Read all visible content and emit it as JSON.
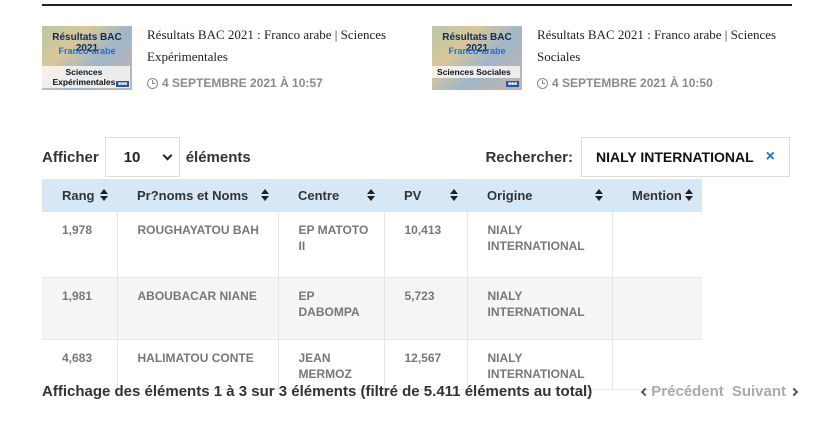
{
  "related": [
    {
      "thumb_line1": "Résultats BAC 2021",
      "thumb_line2": "Franco-arabe",
      "thumb_line3": "Sciences Expérimentales",
      "title": "Résultats BAC 2021 : Franco arabe | Sciences Expérimentales",
      "date": "4 SEPTEMBRE 2021 À 10:57"
    },
    {
      "thumb_line1": "Résultats BAC 2021",
      "thumb_line2": "Franco-arabe",
      "thumb_line3": "Sciences Sociales",
      "title": "Résultats BAC 2021 : Franco arabe | Sciences Sociales",
      "date": "4 SEPTEMBRE 2021 À 10:50"
    }
  ],
  "controls": {
    "show_label": "Afficher",
    "page_length": "10",
    "elements_label": "éléments",
    "search_label": "Rechercher:",
    "search_value": "NIALY INTERNATIONAL",
    "clear_glyph": "×"
  },
  "table": {
    "headers": [
      "Rang",
      "Pr?noms et Noms",
      "Centre",
      "PV",
      "Origine",
      "Mention"
    ],
    "rows": [
      [
        "1,978",
        "ROUGHAYATOU BAH",
        "EP MATOTO II",
        "10,413",
        "NIALY INTERNATIONAL",
        ""
      ],
      [
        "1,981",
        "ABOUBACAR NIANE",
        "EP DABOMPA",
        "5,723",
        "NIALY INTERNATIONAL",
        ""
      ],
      [
        "4,683",
        "HALIMATOU CONTE",
        "JEAN MERMOZ",
        "12,567",
        "NIALY INTERNATIONAL",
        ""
      ]
    ]
  },
  "footer": {
    "info": "Affichage des éléments 1 à 3 sur 3 éléments (filtré de 5.411 éléments au total)",
    "prev": "Précédent",
    "next": "Suivant"
  },
  "colors": {
    "header_bg": "#d6e7f6",
    "accent": "#1f6fd0"
  }
}
